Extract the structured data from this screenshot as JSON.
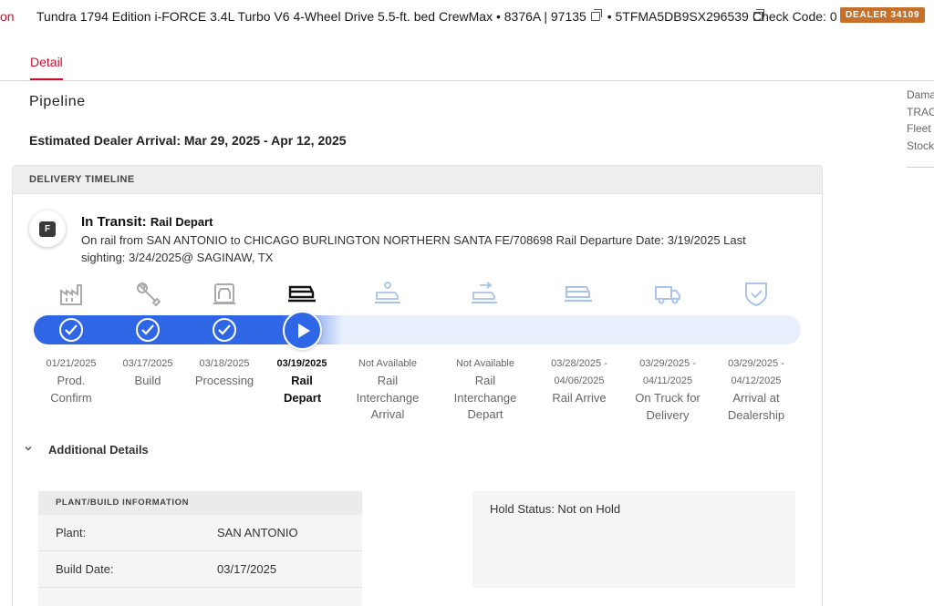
{
  "topbar": {
    "cut_text": "on",
    "vehicle": "Tundra 1794 Edition i-FORCE 3.4L Turbo V6 4-Wheel Drive 5.5-ft. bed CrewMax • 8376A | 97135",
    "vin_prefix": "• 5TFMA5DB9SX296539",
    "check_code": "Check Code: 0",
    "dealer_badge": "DEALER 34109",
    "colors": {
      "accent": "#c8102e",
      "badge": "#c6702a"
    }
  },
  "tabs": [
    {
      "label": "Detail",
      "active": true
    }
  ],
  "sidebar": {
    "items": [
      "Dama",
      "TRAC",
      "Fleet",
      "Stock"
    ]
  },
  "pipeline": {
    "title": "Pipeline",
    "estimated_arrival": "Estimated Dealer Arrival: Mar 29, 2025 - Apr 12, 2025"
  },
  "card": {
    "header": "DELIVERY TIMELINE",
    "status_icon_letter": "F",
    "status_main": "In Transit:",
    "status_sub": "Rail Depart",
    "status_detail": "On rail from SAN ANTONIO to CHICAGO BURLINGTON NORTHERN SANTA FE/708698 Rail Departure Date: 3/19/2025 Last sighting: 3/24/2025@ SAGINAW, TX"
  },
  "timeline": {
    "progress_color": "#2f66e6",
    "current_index": 3,
    "steps": [
      {
        "date": "01/21/2025",
        "label": "Prod. Confirm",
        "icon": "factory-icon",
        "done": true
      },
      {
        "date": "03/17/2025",
        "label": "Build",
        "icon": "wrench-icon",
        "done": true
      },
      {
        "date": "03/18/2025",
        "label": "Processing",
        "icon": "car-processing-icon",
        "done": true
      },
      {
        "date": "03/19/2025",
        "label": "Rail Depart",
        "icon": "rail-car-icon",
        "done": true
      },
      {
        "date": "Not Available",
        "label": "Rail Interchange Arrival",
        "icon": "rail-interchange-arrival-icon",
        "done": false
      },
      {
        "date": "Not Available",
        "label": "Rail Interchange Depart",
        "icon": "rail-interchange-depart-icon",
        "done": false
      },
      {
        "date": "03/28/2025 - 04/06/2025",
        "label": "Rail Arrive",
        "icon": "rail-arrive-icon",
        "done": false
      },
      {
        "date": "03/29/2025 - 04/11/2025",
        "label": "On Truck for Delivery",
        "icon": "truck-icon",
        "done": false
      },
      {
        "date": "03/29/2025 - 04/12/2025",
        "label": "Arrival at Dealership",
        "icon": "shield-check-icon",
        "done": false
      }
    ]
  },
  "additional": {
    "title": "Additional Details",
    "plant_header": "PLANT/BUILD INFORMATION",
    "rows": [
      {
        "key": "Plant:",
        "value": "SAN ANTONIO"
      },
      {
        "key": "Build Date:",
        "value": "03/17/2025"
      }
    ],
    "hold_status": "Hold Status: Not on Hold"
  }
}
